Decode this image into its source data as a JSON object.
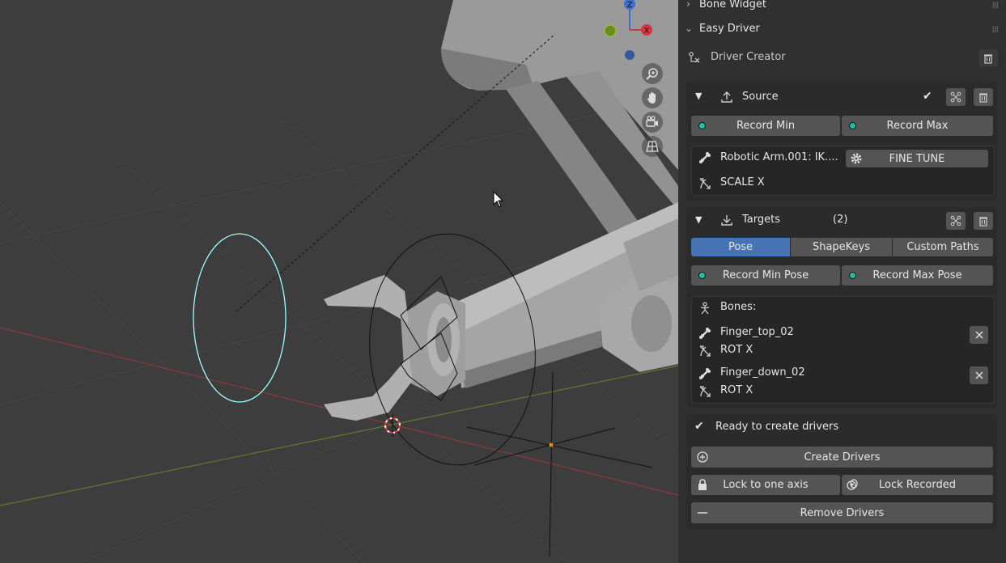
{
  "panel": {
    "bone_widget": {
      "label": "Bone Widget",
      "icon": "chevron-right-icon"
    },
    "easy_driver": {
      "label": "Easy Driver",
      "icon": "chevron-down-icon"
    },
    "driver_creator": {
      "label": "Driver Creator"
    },
    "source": {
      "label": "Source",
      "record_min": "Record Min",
      "record_max": "Record Max",
      "bone_name": "Robotic Arm.001: IK....",
      "fine_tune": "FINE TUNE",
      "transform": "SCALE X"
    },
    "targets": {
      "label": "Targets",
      "count": "(2)",
      "tabs": [
        "Pose",
        "ShapeKeys",
        "Custom Paths"
      ],
      "active_tab": "Pose",
      "record_min_pose": "Record Min Pose",
      "record_max_pose": "Record Max Pose",
      "bones_label": "Bones:",
      "bones": [
        {
          "name": "Finger_top_02",
          "transform": "ROT X"
        },
        {
          "name": "Finger_down_02",
          "transform": "ROT X"
        }
      ]
    },
    "status": "Ready to create drivers",
    "actions": {
      "create": "Create Drivers",
      "lock_axis": "Lock to one axis",
      "lock_recorded": "Lock Recorded",
      "remove": "Remove Drivers"
    }
  },
  "gizmo": {
    "z": "Z",
    "x": "X"
  },
  "colors": {
    "accent": "#4772b3",
    "record_dot": "#1fc1a1",
    "panel_bg": "#303030",
    "viewport_bg": "#3d3d3d"
  }
}
